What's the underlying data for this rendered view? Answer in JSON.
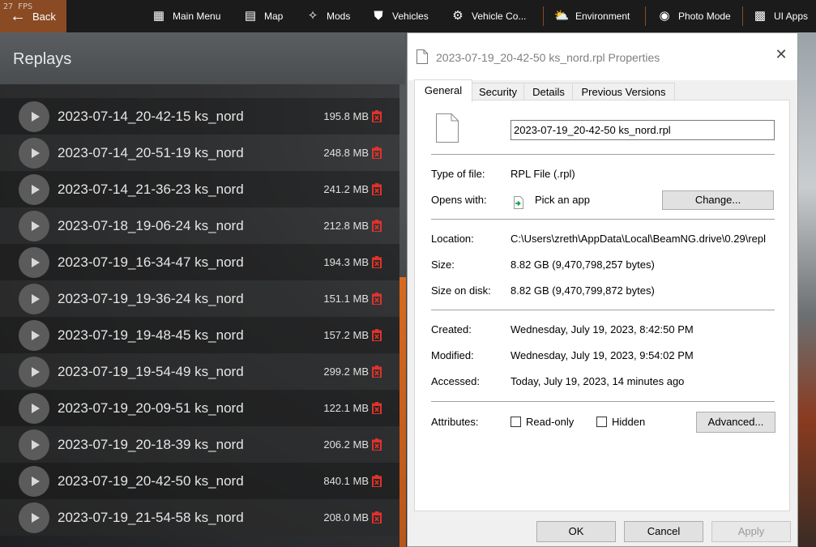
{
  "topbar": {
    "fps": "27 FPS",
    "back_label": "Back",
    "menu": [
      {
        "label": "Main Menu",
        "icon": "grid-icon"
      },
      {
        "label": "Map",
        "icon": "map-icon"
      },
      {
        "label": "Mods",
        "icon": "puzzle-icon"
      },
      {
        "label": "Vehicles",
        "icon": "car-icon"
      },
      {
        "label": "Vehicle Co...",
        "icon": "engine-icon"
      },
      {
        "label": "Environment",
        "icon": "weather-icon"
      },
      {
        "label": "Photo Mode",
        "icon": "camera-icon"
      },
      {
        "label": "UI Apps",
        "icon": "apps-icon"
      }
    ]
  },
  "replays": {
    "title": "Replays",
    "items": [
      {
        "name": "2023-07-14_20-42-15 ks_nord",
        "size": "195.8 MB"
      },
      {
        "name": "2023-07-14_20-51-19 ks_nord",
        "size": "248.8 MB"
      },
      {
        "name": "2023-07-14_21-36-23 ks_nord",
        "size": "241.2 MB"
      },
      {
        "name": "2023-07-18_19-06-24 ks_nord",
        "size": "212.8 MB"
      },
      {
        "name": "2023-07-19_16-34-47 ks_nord",
        "size": "194.3 MB"
      },
      {
        "name": "2023-07-19_19-36-24 ks_nord",
        "size": "151.1 MB"
      },
      {
        "name": "2023-07-19_19-48-45 ks_nord",
        "size": "157.2 MB"
      },
      {
        "name": "2023-07-19_19-54-49 ks_nord",
        "size": "299.2 MB"
      },
      {
        "name": "2023-07-19_20-09-51 ks_nord",
        "size": "122.1 MB"
      },
      {
        "name": "2023-07-19_20-18-39 ks_nord",
        "size": "206.2 MB"
      },
      {
        "name": "2023-07-19_20-42-50 ks_nord",
        "size": "840.1 MB"
      },
      {
        "name": "2023-07-19_21-54-58 ks_nord",
        "size": "208.0 MB"
      }
    ]
  },
  "dialog": {
    "title": "2023-07-19_20-42-50 ks_nord.rpl Properties",
    "tabs": [
      "General",
      "Security",
      "Details",
      "Previous Versions"
    ],
    "filename": "2023-07-19_20-42-50 ks_nord.rpl",
    "type_label": "Type of file:",
    "type_value": "RPL File (.rpl)",
    "opens_label": "Opens with:",
    "opens_value": "Pick an app",
    "change_label": "Change...",
    "location_label": "Location:",
    "location_value": "C:\\Users\\zreth\\AppData\\Local\\BeamNG.drive\\0.29\\repl",
    "size_label": "Size:",
    "size_value": "8.82 GB (9,470,798,257 bytes)",
    "disk_label": "Size on disk:",
    "disk_value": "8.82 GB (9,470,799,872 bytes)",
    "created_label": "Created:",
    "created_value": "Wednesday, July 19, 2023, 8:42:50 PM",
    "modified_label": "Modified:",
    "modified_value": "Wednesday, July 19, 2023, 9:54:02 PM",
    "accessed_label": "Accessed:",
    "accessed_value": "Today, July 19, 2023, 14 minutes ago",
    "attributes_label": "Attributes:",
    "readonly_label": "Read-only",
    "hidden_label": "Hidden",
    "advanced_label": "Advanced...",
    "ok_label": "OK",
    "cancel_label": "Cancel",
    "apply_label": "Apply"
  },
  "colors": {
    "accent_orange": "#d96a1f",
    "back_button": "#8a4a24",
    "trash_red": "#e0322b"
  }
}
